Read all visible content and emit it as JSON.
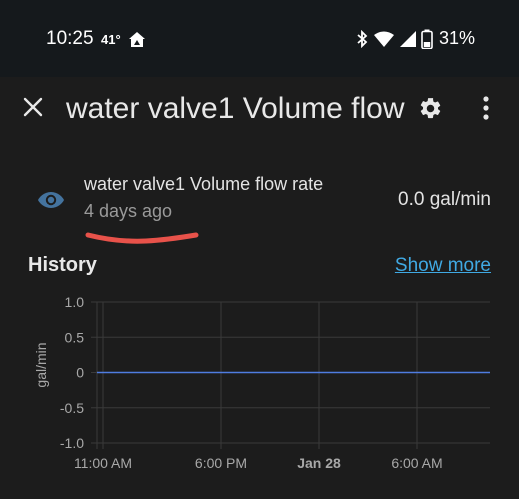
{
  "status_bar": {
    "time": "10:25",
    "temperature": "41°",
    "battery_percent": "31%",
    "icons": [
      "home-icon",
      "bluetooth-icon",
      "wifi-icon",
      "signal-icon",
      "battery-icon"
    ]
  },
  "header": {
    "title": "water valve1 Volume flow",
    "close_icon": "close-icon",
    "settings_icon": "gear-icon",
    "more_icon": "more-vert-icon"
  },
  "entity": {
    "name": "water valve1 Volume flow rate",
    "last_changed": "4 days ago",
    "state": "0.0 gal/min",
    "icon": "eye-icon"
  },
  "history": {
    "title": "History",
    "show_more_label": "Show more"
  },
  "colors": {
    "accent": "#40a9e3",
    "line": "#4f7ce0",
    "annotation": "#e8524a",
    "background": "#1c1c1c",
    "status_bar": "#15191c"
  },
  "chart_data": {
    "type": "line",
    "ylabel": "gal/min",
    "ylim": [
      -1.0,
      1.0
    ],
    "y_ticks": [
      "1.0",
      "0.5",
      "0",
      "-0.5",
      "-1.0"
    ],
    "x_ticks": [
      "11:00 AM",
      "6:00 PM",
      "Jan 28",
      "6:00 AM"
    ],
    "series": [
      {
        "values": [
          0,
          0
        ]
      }
    ],
    "grid": true
  }
}
